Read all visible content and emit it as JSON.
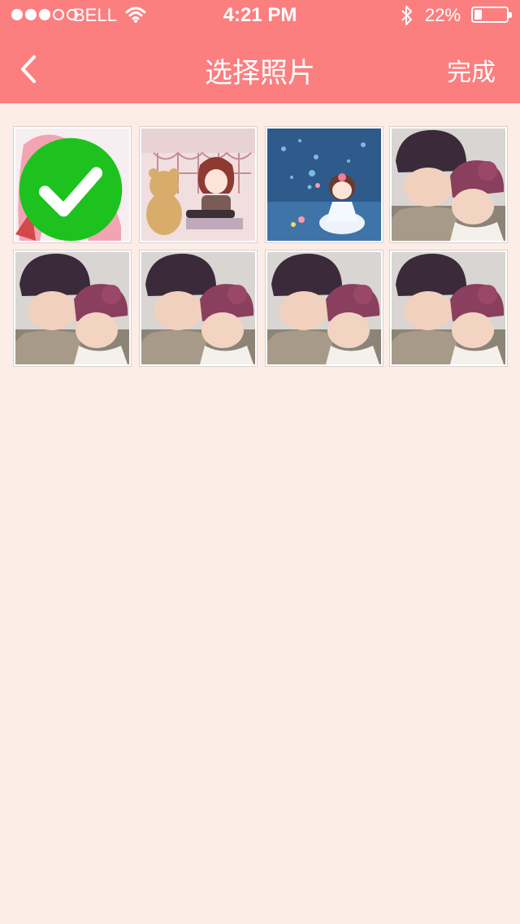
{
  "status_bar": {
    "carrier": "BELL",
    "time": "4:21 PM",
    "battery_percent": "22%",
    "battery_level": 0.22,
    "signal_bars_filled": 3,
    "signal_bars_total": 5,
    "icons": [
      "wifi-icon",
      "bluetooth-icon",
      "battery-icon"
    ]
  },
  "nav": {
    "title": "选择照片",
    "done_label": "完成",
    "back_icon": "chevron-left-icon"
  },
  "photos": [
    {
      "subject": "anime girl with pink hair",
      "selected": true
    },
    {
      "subject": "anime girl with teddy bear",
      "selected": false
    },
    {
      "subject": "cartoon girl with bubbles",
      "selected": false
    },
    {
      "subject": "two children in knit hats",
      "selected": false
    },
    {
      "subject": "two children in knit hats",
      "selected": false
    },
    {
      "subject": "two children in knit hats",
      "selected": false
    },
    {
      "subject": "two children in knit hats",
      "selected": false
    },
    {
      "subject": "two children in knit hats",
      "selected": false
    }
  ],
  "colors": {
    "header": "#fc7f80",
    "background": "#fcede6",
    "selected_check": "#1ec21e"
  }
}
